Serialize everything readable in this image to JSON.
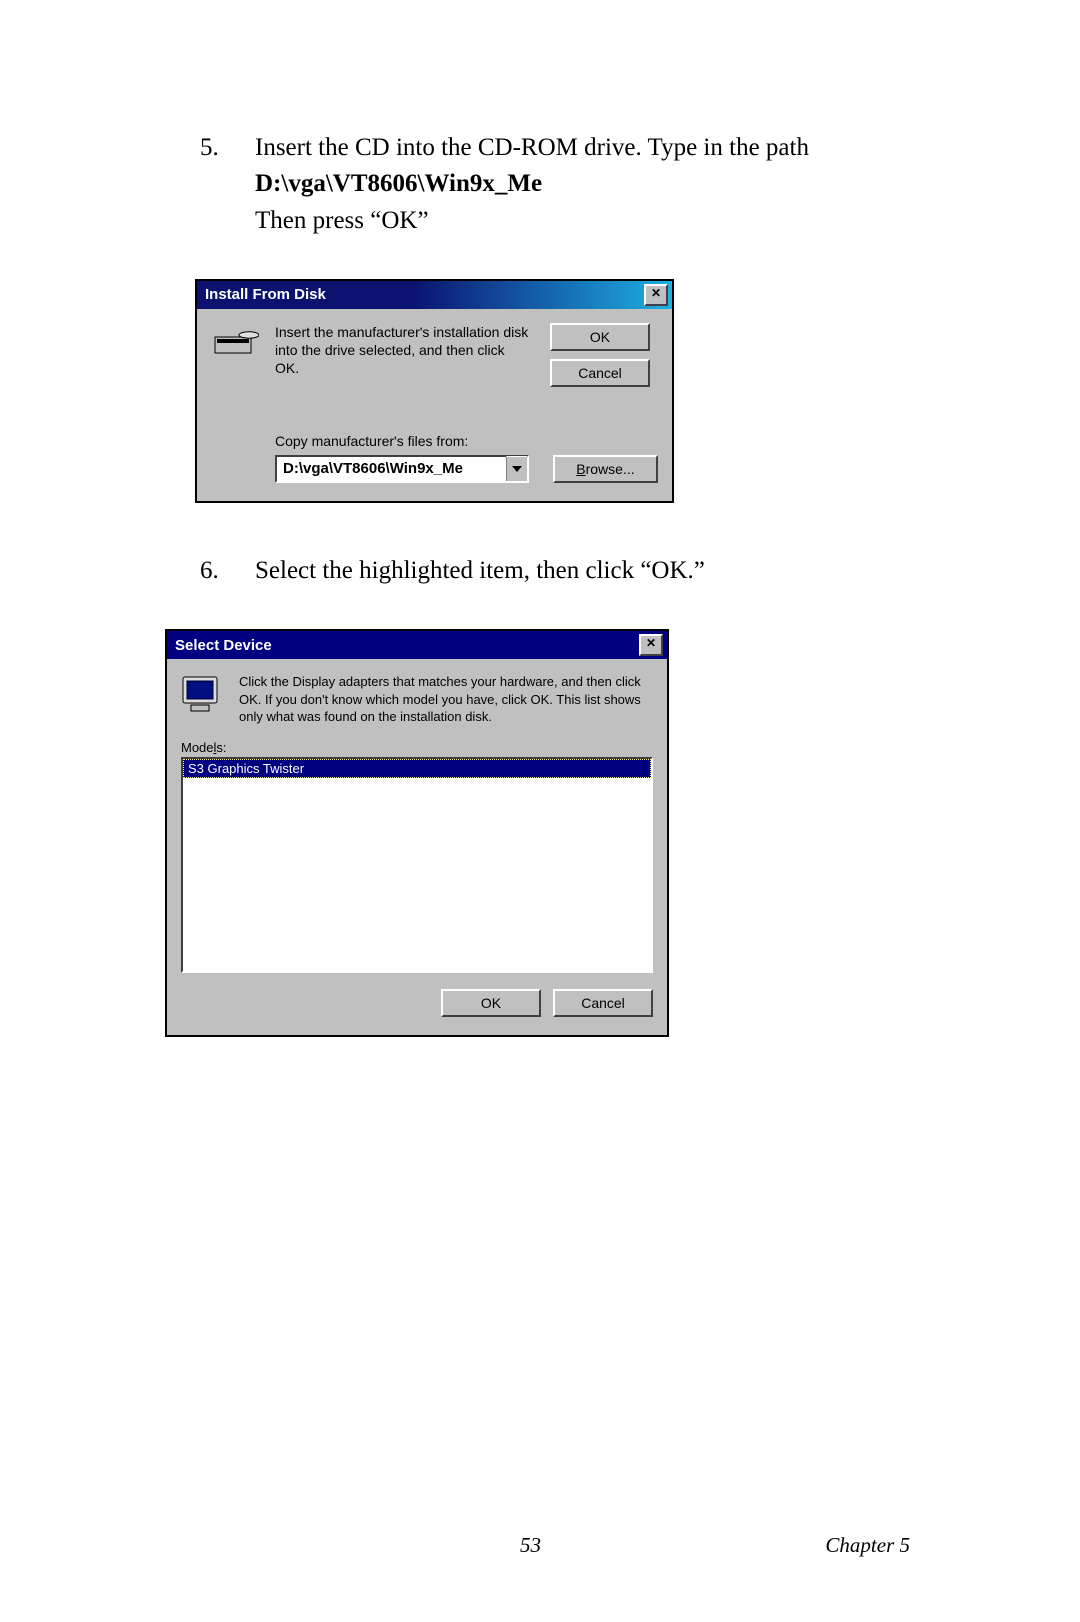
{
  "steps": {
    "s5": {
      "num": "5.",
      "line1": "Insert the CD into the CD-ROM drive. Type in the path",
      "path": "D:\\vga\\VT8606\\Win9x_Me",
      "line2": "Then press “OK”"
    },
    "s6": {
      "num": "6.",
      "text": "Select the highlighted item, then click “OK.”"
    }
  },
  "dialog1": {
    "title": "Install From Disk",
    "msg": "Insert the manufacturer's installation disk into the drive selected, and then click OK.",
    "copy_label": "Copy manufacturer's files from:",
    "path_value": "D:\\vga\\VT8606\\Win9x_Me",
    "ok": "OK",
    "cancel": "Cancel",
    "browse_pre": "B",
    "browse_post": "rowse..."
  },
  "dialog2": {
    "title": "Select Device",
    "msg": "Click the Display adapters that matches your hardware, and then click OK. If you don't know which model you have, click OK. This list shows only what was found on the installation disk.",
    "models_pre": "Mode",
    "models_u": "l",
    "models_post": "s:",
    "selected": "S3 Graphics Twister",
    "ok": "OK",
    "cancel": "Cancel"
  },
  "footer": {
    "page": "53",
    "chapter": "Chapter 5"
  }
}
